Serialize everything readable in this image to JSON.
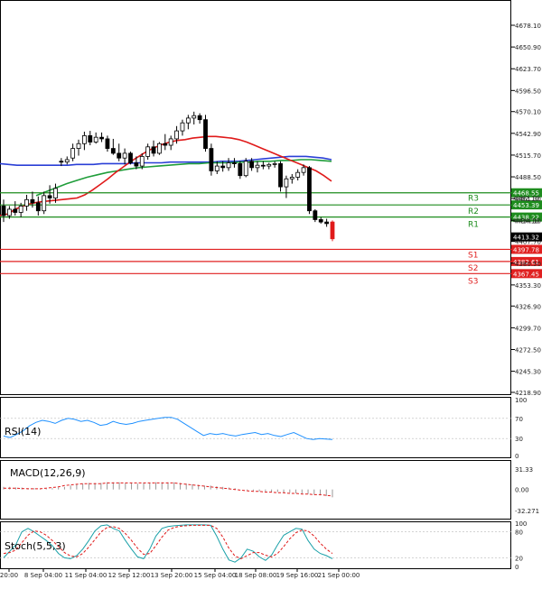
{
  "chart_data": {
    "type": "candlestick",
    "main": {
      "y_ticks": [
        "4678.10",
        "4650.90",
        "4623.70",
        "4596.50",
        "4570.10",
        "4542.90",
        "4515.70",
        "4488.50",
        "4461.30",
        "4434.10",
        "4407.70",
        "4380.50",
        "4353.30",
        "4326.90",
        "4299.70",
        "4272.50",
        "4245.30",
        "4218.90"
      ],
      "ylim": [
        4218.9,
        4678.1
      ],
      "current_price": "4413.32",
      "levels": [
        {
          "name": "R3",
          "price": 4468.55,
          "label": "4468.55",
          "color": "#1e8c1e"
        },
        {
          "name": "R2",
          "price": 4453.39,
          "label": "4453.39",
          "color": "#1e8c1e"
        },
        {
          "name": "R1",
          "price": 4438.22,
          "label": "4438.22",
          "color": "#1e8c1e"
        },
        {
          "name": "S1",
          "price": 4397.78,
          "label": "4397.78",
          "color": "#e02020"
        },
        {
          "name": "S2",
          "price": 4382.61,
          "label": "4382.61",
          "color": "#e02020"
        },
        {
          "name": "S3",
          "price": 4367.45,
          "label": "4367.45",
          "color": "#e02020"
        }
      ],
      "overlapped_labels": [
        "4462.10",
        "4434.10"
      ],
      "candles": [
        {
          "o": 4452,
          "h": 4460,
          "l": 4432,
          "c": 4440
        },
        {
          "o": 4440,
          "h": 4452,
          "l": 4436,
          "c": 4448
        },
        {
          "o": 4448,
          "h": 4458,
          "l": 4440,
          "c": 4444
        },
        {
          "o": 4444,
          "h": 4456,
          "l": 4438,
          "c": 4452
        },
        {
          "o": 4452,
          "h": 4466,
          "l": 4446,
          "c": 4460
        },
        {
          "o": 4460,
          "h": 4470,
          "l": 4450,
          "c": 4456
        },
        {
          "o": 4456,
          "h": 4464,
          "l": 4440,
          "c": 4446
        },
        {
          "o": 4446,
          "h": 4470,
          "l": 4442,
          "c": 4465
        },
        {
          "o": 4465,
          "h": 4478,
          "l": 4455,
          "c": 4462
        },
        {
          "o": 4462,
          "h": 4480,
          "l": 4456,
          "c": 4474
        },
        {
          "o": 4508,
          "h": 4512,
          "l": 4502,
          "c": 4507
        },
        {
          "o": 4507,
          "h": 4514,
          "l": 4504,
          "c": 4510
        },
        {
          "o": 4512,
          "h": 4530,
          "l": 4508,
          "c": 4524
        },
        {
          "o": 4524,
          "h": 4535,
          "l": 4515,
          "c": 4530
        },
        {
          "o": 4530,
          "h": 4545,
          "l": 4522,
          "c": 4540
        },
        {
          "o": 4540,
          "h": 4546,
          "l": 4528,
          "c": 4532
        },
        {
          "o": 4532,
          "h": 4544,
          "l": 4530,
          "c": 4538
        },
        {
          "o": 4538,
          "h": 4544,
          "l": 4532,
          "c": 4536
        },
        {
          "o": 4536,
          "h": 4540,
          "l": 4520,
          "c": 4524
        },
        {
          "o": 4524,
          "h": 4536,
          "l": 4516,
          "c": 4518
        },
        {
          "o": 4518,
          "h": 4530,
          "l": 4508,
          "c": 4512
        },
        {
          "o": 4512,
          "h": 4524,
          "l": 4504,
          "c": 4518
        },
        {
          "o": 4518,
          "h": 4520,
          "l": 4504,
          "c": 4506
        },
        {
          "o": 4506,
          "h": 4514,
          "l": 4498,
          "c": 4502
        },
        {
          "o": 4502,
          "h": 4518,
          "l": 4498,
          "c": 4514
        },
        {
          "o": 4514,
          "h": 4530,
          "l": 4510,
          "c": 4526
        },
        {
          "o": 4526,
          "h": 4534,
          "l": 4514,
          "c": 4518
        },
        {
          "o": 4518,
          "h": 4532,
          "l": 4516,
          "c": 4530
        },
        {
          "o": 4530,
          "h": 4542,
          "l": 4522,
          "c": 4528
        },
        {
          "o": 4528,
          "h": 4540,
          "l": 4522,
          "c": 4536
        },
        {
          "o": 4536,
          "h": 4552,
          "l": 4530,
          "c": 4546
        },
        {
          "o": 4546,
          "h": 4560,
          "l": 4540,
          "c": 4556
        },
        {
          "o": 4556,
          "h": 4566,
          "l": 4548,
          "c": 4562
        },
        {
          "o": 4562,
          "h": 4570,
          "l": 4554,
          "c": 4565
        },
        {
          "o": 4565,
          "h": 4568,
          "l": 4555,
          "c": 4560
        },
        {
          "o": 4560,
          "h": 4566,
          "l": 4520,
          "c": 4524
        },
        {
          "o": 4524,
          "h": 4530,
          "l": 4490,
          "c": 4496
        },
        {
          "o": 4496,
          "h": 4508,
          "l": 4492,
          "c": 4502
        },
        {
          "o": 4502,
          "h": 4508,
          "l": 4495,
          "c": 4500
        },
        {
          "o": 4500,
          "h": 4512,
          "l": 4496,
          "c": 4506
        },
        {
          "o": 4506,
          "h": 4512,
          "l": 4500,
          "c": 4505
        },
        {
          "o": 4505,
          "h": 4508,
          "l": 4486,
          "c": 4490
        },
        {
          "o": 4490,
          "h": 4512,
          "l": 4488,
          "c": 4508
        },
        {
          "o": 4508,
          "h": 4512,
          "l": 4496,
          "c": 4500
        },
        {
          "o": 4500,
          "h": 4508,
          "l": 4494,
          "c": 4503
        },
        {
          "o": 4503,
          "h": 4508,
          "l": 4498,
          "c": 4502
        },
        {
          "o": 4502,
          "h": 4506,
          "l": 4498,
          "c": 4504
        },
        {
          "o": 4504,
          "h": 4508,
          "l": 4500,
          "c": 4505
        },
        {
          "o": 4505,
          "h": 4508,
          "l": 4470,
          "c": 4476
        },
        {
          "o": 4476,
          "h": 4490,
          "l": 4462,
          "c": 4486
        },
        {
          "o": 4486,
          "h": 4492,
          "l": 4480,
          "c": 4488
        },
        {
          "o": 4488,
          "h": 4498,
          "l": 4484,
          "c": 4494
        },
        {
          "o": 4494,
          "h": 4504,
          "l": 4490,
          "c": 4500
        },
        {
          "o": 4500,
          "h": 4502,
          "l": 4442,
          "c": 4446
        },
        {
          "o": 4446,
          "h": 4448,
          "l": 4432,
          "c": 4435
        },
        {
          "o": 4435,
          "h": 4438,
          "l": 4430,
          "c": 4432
        },
        {
          "o": 4432,
          "h": 4436,
          "l": 4426,
          "c": 4430
        },
        {
          "o": 4432,
          "h": 4434,
          "l": 4408,
          "c": 4411
        }
      ],
      "ma_red": [
        4440,
        4442,
        4448,
        4452,
        4455,
        4457,
        4458,
        4459,
        4460,
        4461,
        4462,
        4466,
        4472,
        4479,
        4486,
        4494,
        4501,
        4508,
        4514,
        4520,
        4525,
        4529,
        4532,
        4534,
        4535,
        4537,
        4538,
        4539,
        4539,
        4538,
        4537,
        4535,
        4532,
        4528,
        4524,
        4520,
        4516,
        4512,
        4508,
        4504,
        4500,
        4496,
        4490,
        4483
      ],
      "ma_blue": [
        4505,
        4504,
        4503,
        4503,
        4503,
        4503,
        4503,
        4503,
        4503,
        4504,
        4504,
        4504,
        4505,
        4505,
        4505,
        4505,
        4506,
        4506,
        4506,
        4506,
        4507,
        4507,
        4507,
        4507,
        4507,
        4507,
        4508,
        4508,
        4508,
        4509,
        4510,
        4511,
        4512,
        4513,
        4514,
        4514,
        4514,
        4513,
        4512,
        4510
      ],
      "ma_green": [
        4465,
        4470,
        4475,
        4480,
        4484,
        4488,
        4491,
        4494,
        4496,
        4498,
        4500,
        4501,
        4502,
        4503,
        4504,
        4505,
        4505,
        4506,
        4506,
        4506,
        4507,
        4507,
        4508,
        4508,
        4509,
        4509,
        4510,
        4510,
        4509,
        4508
      ]
    },
    "x_ticks": [
      "20:00",
      "8 Sep 04:00",
      "11 Sep 04:00",
      "12 Sep 12:00",
      "13 Sep 20:00",
      "15 Sep 04:00",
      "18 Sep 08:00",
      "19 Sep 16:00",
      "21 Sep 00:00"
    ],
    "rsi": {
      "label": "RSI(14)",
      "ticks": [
        "100",
        "70",
        "30",
        "0"
      ],
      "values": [
        35,
        32,
        38,
        45,
        55,
        62,
        66,
        64,
        60,
        66,
        70,
        68,
        64,
        66,
        62,
        56,
        58,
        64,
        60,
        58,
        60,
        64,
        66,
        68,
        70,
        72,
        72,
        68,
        60,
        52,
        44,
        36,
        40,
        38,
        40,
        37,
        35,
        38,
        40,
        42,
        38,
        40,
        36,
        34,
        38,
        42,
        36,
        30,
        28,
        30,
        29,
        28
      ]
    },
    "macd": {
      "label": "MACD(12,26,9)",
      "ticks": [
        "31.33",
        "0.00",
        "-32.271"
      ],
      "hist": [
        4,
        4,
        3,
        3,
        2,
        2,
        1,
        1,
        2,
        3,
        4,
        6,
        8,
        9,
        10,
        10,
        10,
        11,
        11,
        11,
        10,
        10,
        9,
        10,
        10,
        11,
        11,
        11,
        11,
        10,
        9,
        8,
        7,
        6,
        6,
        5,
        4,
        3,
        2,
        0,
        -1,
        -2,
        -3,
        -3,
        -4,
        -4,
        -5,
        -5,
        -6,
        -6,
        -7,
        -8,
        -9,
        -10,
        -12
      ],
      "signal": [
        2,
        2,
        2,
        1.5,
        1,
        1,
        1,
        2,
        3,
        4,
        6,
        7,
        8,
        9,
        9,
        9,
        9,
        10,
        10,
        10,
        10,
        10,
        10,
        10,
        10,
        10,
        10,
        10,
        10,
        9,
        8,
        7,
        6,
        5,
        4,
        3,
        2,
        1,
        0,
        -1,
        -2,
        -3,
        -3,
        -4,
        -4,
        -5,
        -5,
        -6,
        -6,
        -7,
        -7,
        -8,
        -8,
        -9,
        -10
      ]
    },
    "stoch": {
      "label": "Stoch(5,5,3)",
      "ticks": [
        "100",
        "80",
        "20",
        "0"
      ],
      "k": [
        20,
        35,
        50,
        80,
        88,
        80,
        70,
        60,
        48,
        30,
        20,
        18,
        25,
        40,
        60,
        82,
        94,
        96,
        88,
        82,
        60,
        40,
        22,
        18,
        40,
        70,
        88,
        92,
        94,
        95,
        96,
        96,
        96,
        96,
        95,
        70,
        40,
        15,
        10,
        20,
        40,
        35,
        22,
        14,
        26,
        50,
        72,
        80,
        88,
        86,
        60,
        40,
        30,
        25,
        18
      ],
      "d": [
        30,
        32,
        38,
        55,
        72,
        82,
        80,
        72,
        60,
        46,
        32,
        24,
        22,
        30,
        45,
        62,
        80,
        90,
        92,
        88,
        76,
        60,
        42,
        28,
        30,
        48,
        68,
        84,
        90,
        93,
        94,
        95,
        95,
        95,
        95,
        88,
        68,
        42,
        24,
        18,
        25,
        32,
        32,
        26,
        22,
        30,
        46,
        64,
        78,
        84,
        82,
        70,
        54,
        40,
        30
      ]
    }
  }
}
